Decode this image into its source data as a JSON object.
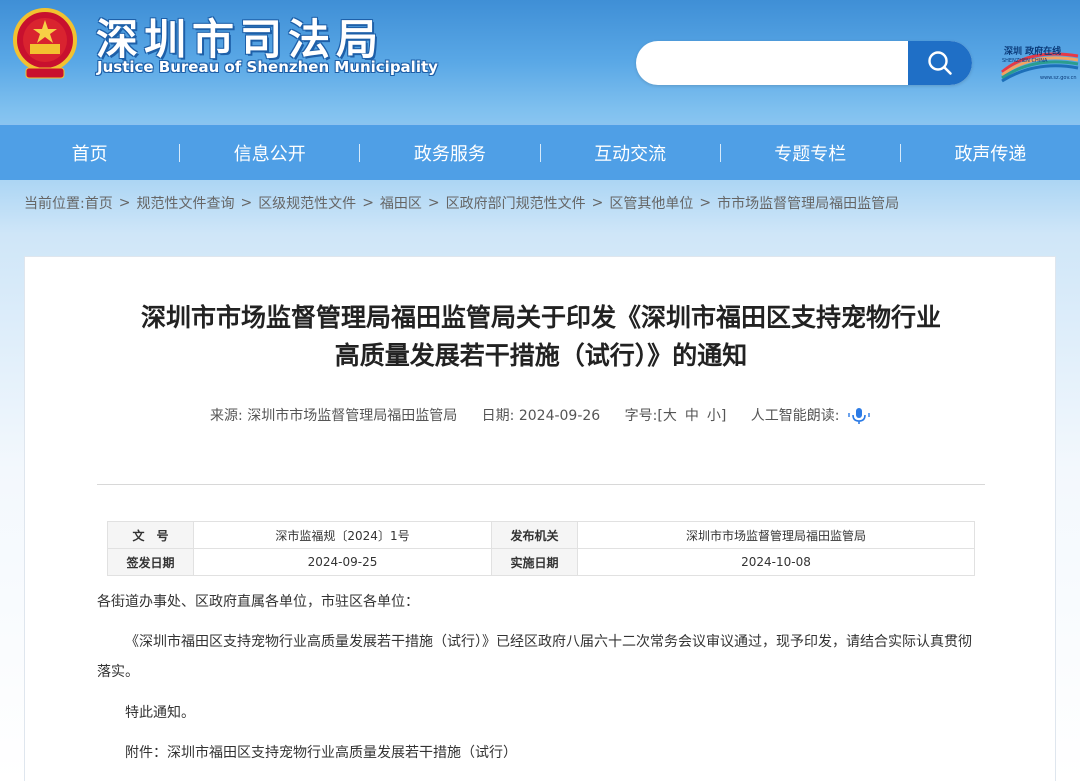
{
  "header": {
    "title_cn": "深圳市司法局",
    "title_en": "Justice Bureau of Shenzhen Municipality",
    "search_placeholder": "",
    "emblem_icon": "national-emblem-icon",
    "logo_text_main": "深圳 政府在线",
    "logo_text_sub": "SHENZHEN CHINA",
    "logo_url_text": "www.sz.gov.cn"
  },
  "nav": {
    "items": [
      "首页",
      "信息公开",
      "政务服务",
      "互动交流",
      "专题专栏",
      "政声传递"
    ]
  },
  "breadcrumb": {
    "prefix": "当前位置:",
    "items": [
      "首页",
      "规范性文件查询",
      "区级规范性文件",
      "福田区",
      "区政府部门规范性文件",
      "区管其他单位",
      "市市场监督管理局福田监管局"
    ],
    "separator": ">"
  },
  "article": {
    "title_line1": "深圳市市场监督管理局福田监管局关于印发《深圳市福田区支持宠物行业",
    "title_line2": "高质量发展若干措施（试行）》的通知",
    "meta": {
      "source_label": "来源:",
      "source": "深圳市市场监督管理局福田监管局",
      "date_label": "日期:",
      "date": "2024-09-26",
      "font_label": "字号:",
      "font_open": "[",
      "font_large": "大",
      "font_medium": "中",
      "font_small": "小",
      "font_close": "]",
      "tts_label": "人工智能朗读:"
    },
    "info_table": {
      "doc_no_label": "文　号",
      "doc_no": "深市监福规〔2024〕1号",
      "issuer_label": "发布机关",
      "issuer": "深圳市市场监督管理局福田监管局",
      "sign_date_label": "签发日期",
      "sign_date": "2024-09-25",
      "effective_label": "实施日期",
      "effective_date": "2024-10-08"
    },
    "paragraphs": {
      "salutation": "各街道办事处、区政府直属各单位，市驻区各单位：",
      "body": "《深圳市福田区支持宠物行业高质量发展若干措施（试行）》已经区政府八届六十二次常务会议审议通过，现予印发，请结合实际认真贯彻落实。",
      "notice": "特此通知。",
      "attachment": "附件：深圳市福田区支持宠物行业高质量发展若干措施（试行）"
    }
  },
  "colors": {
    "nav_bg": "#4f9fe6",
    "search_btn": "#1f6fc6",
    "header_top": "#3f8fd6"
  }
}
